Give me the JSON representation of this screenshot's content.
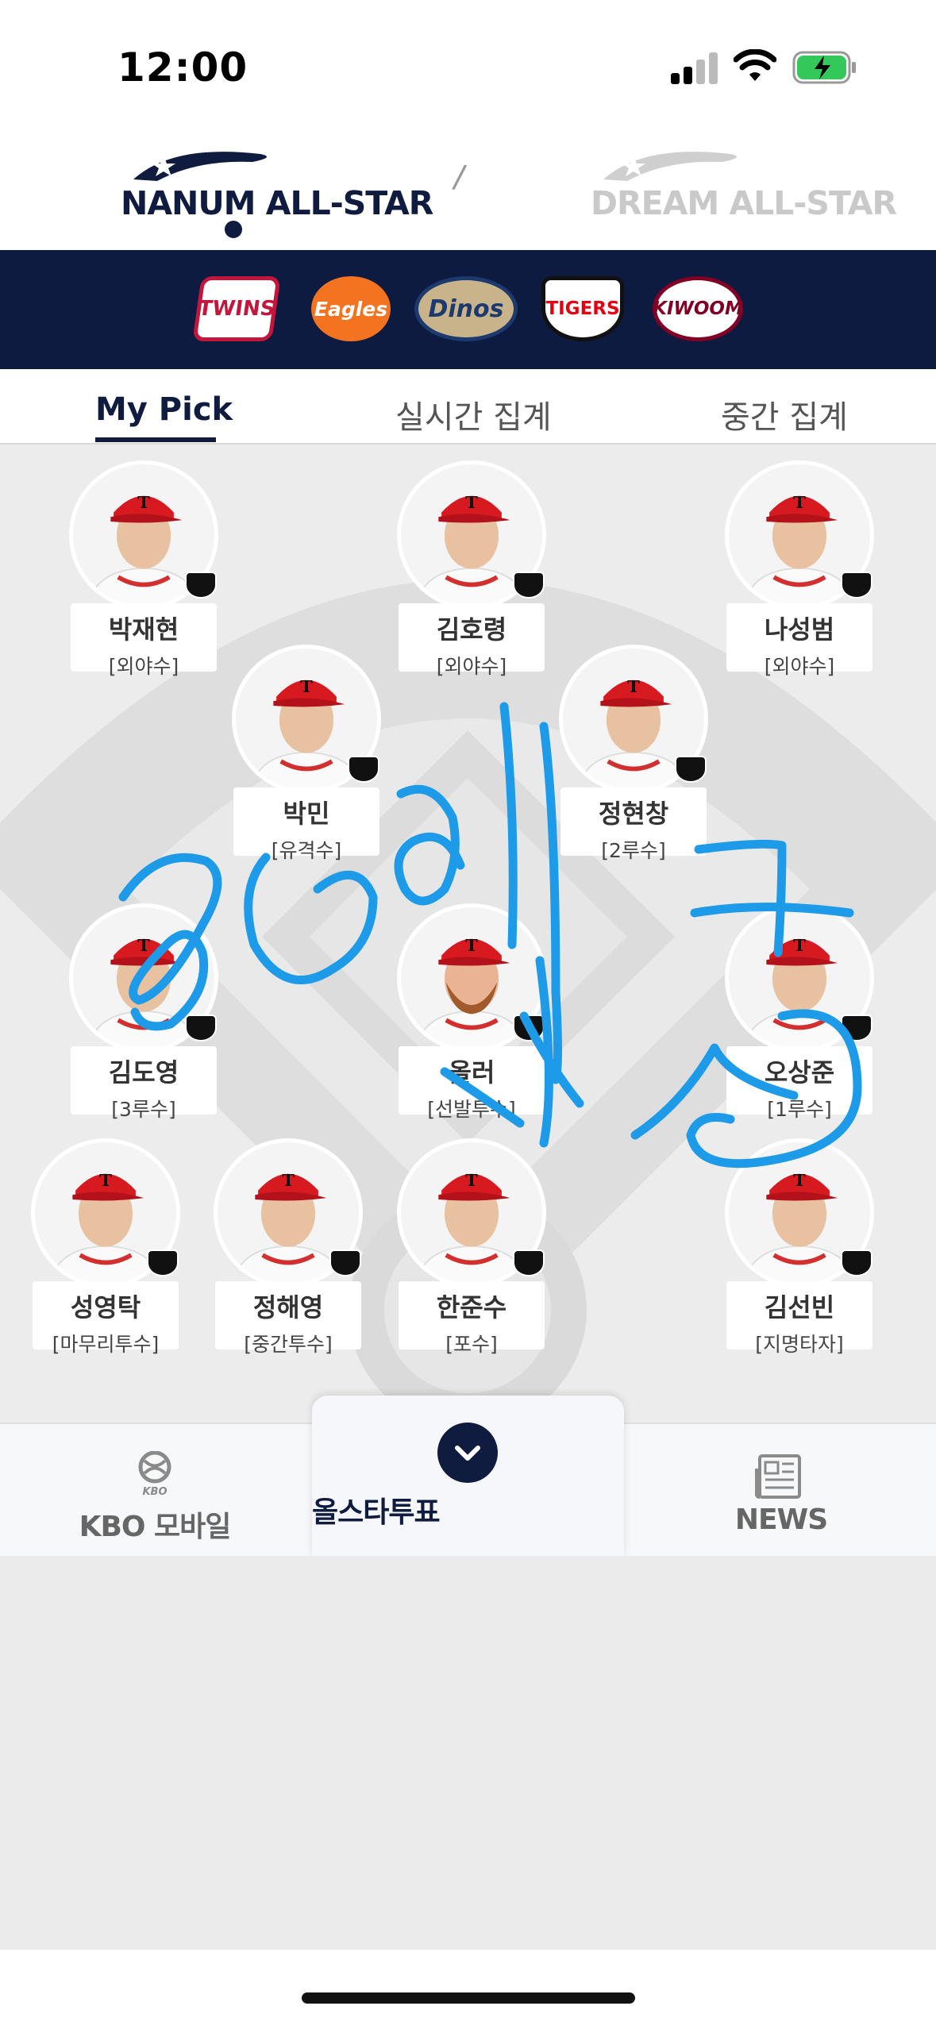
{
  "status_bar": {
    "time": "12:00"
  },
  "header": {
    "nanum_logo": "NANUM ALL-STAR",
    "separator": "/",
    "dream_logo": "DREAM ALL-STAR"
  },
  "teams": [
    {
      "name": "TWINS"
    },
    {
      "name": "Eagles"
    },
    {
      "name": "Dinos"
    },
    {
      "name": "TIGERS"
    },
    {
      "name": "KIWOOM"
    }
  ],
  "tabs": [
    {
      "label": "My Pick"
    },
    {
      "label": "실시간 집계"
    },
    {
      "label": "중간 집계"
    }
  ],
  "players": [
    {
      "name": "박재현",
      "position": "[외야수]",
      "team": "TIGERS"
    },
    {
      "name": "김호령",
      "position": "[외야수]",
      "team": "TIGERS"
    },
    {
      "name": "나성범",
      "position": "[외야수]",
      "team": "TIGERS"
    },
    {
      "name": "박민",
      "position": "[유격수]",
      "team": "TIGERS"
    },
    {
      "name": "정현창",
      "position": "[2루수]",
      "team": "TIGERS"
    },
    {
      "name": "김도영",
      "position": "[3루수]",
      "team": "TIGERS"
    },
    {
      "name": "올러",
      "position": "[선발투수]",
      "team": "TIGERS"
    },
    {
      "name": "오상준",
      "position": "[1루수]",
      "team": "TIGERS"
    },
    {
      "name": "성영탁",
      "position": "[마무리투수]",
      "team": "TIGERS"
    },
    {
      "name": "정해영",
      "position": "[중간투수]",
      "team": "TIGERS"
    },
    {
      "name": "한준수",
      "position": "[포수]",
      "team": "TIGERS"
    },
    {
      "name": "김선빈",
      "position": "[지명타자]",
      "team": "TIGERS"
    }
  ],
  "bottom_nav": {
    "left_label": "KBO 모바일",
    "kbo_icon_text": "KBO",
    "center_label": "올스타투표",
    "right_label": "NEWS"
  },
  "colors": {
    "navy": "#0d1b40",
    "scribble": "#1e9be8",
    "tigers_red": "#e50012"
  }
}
